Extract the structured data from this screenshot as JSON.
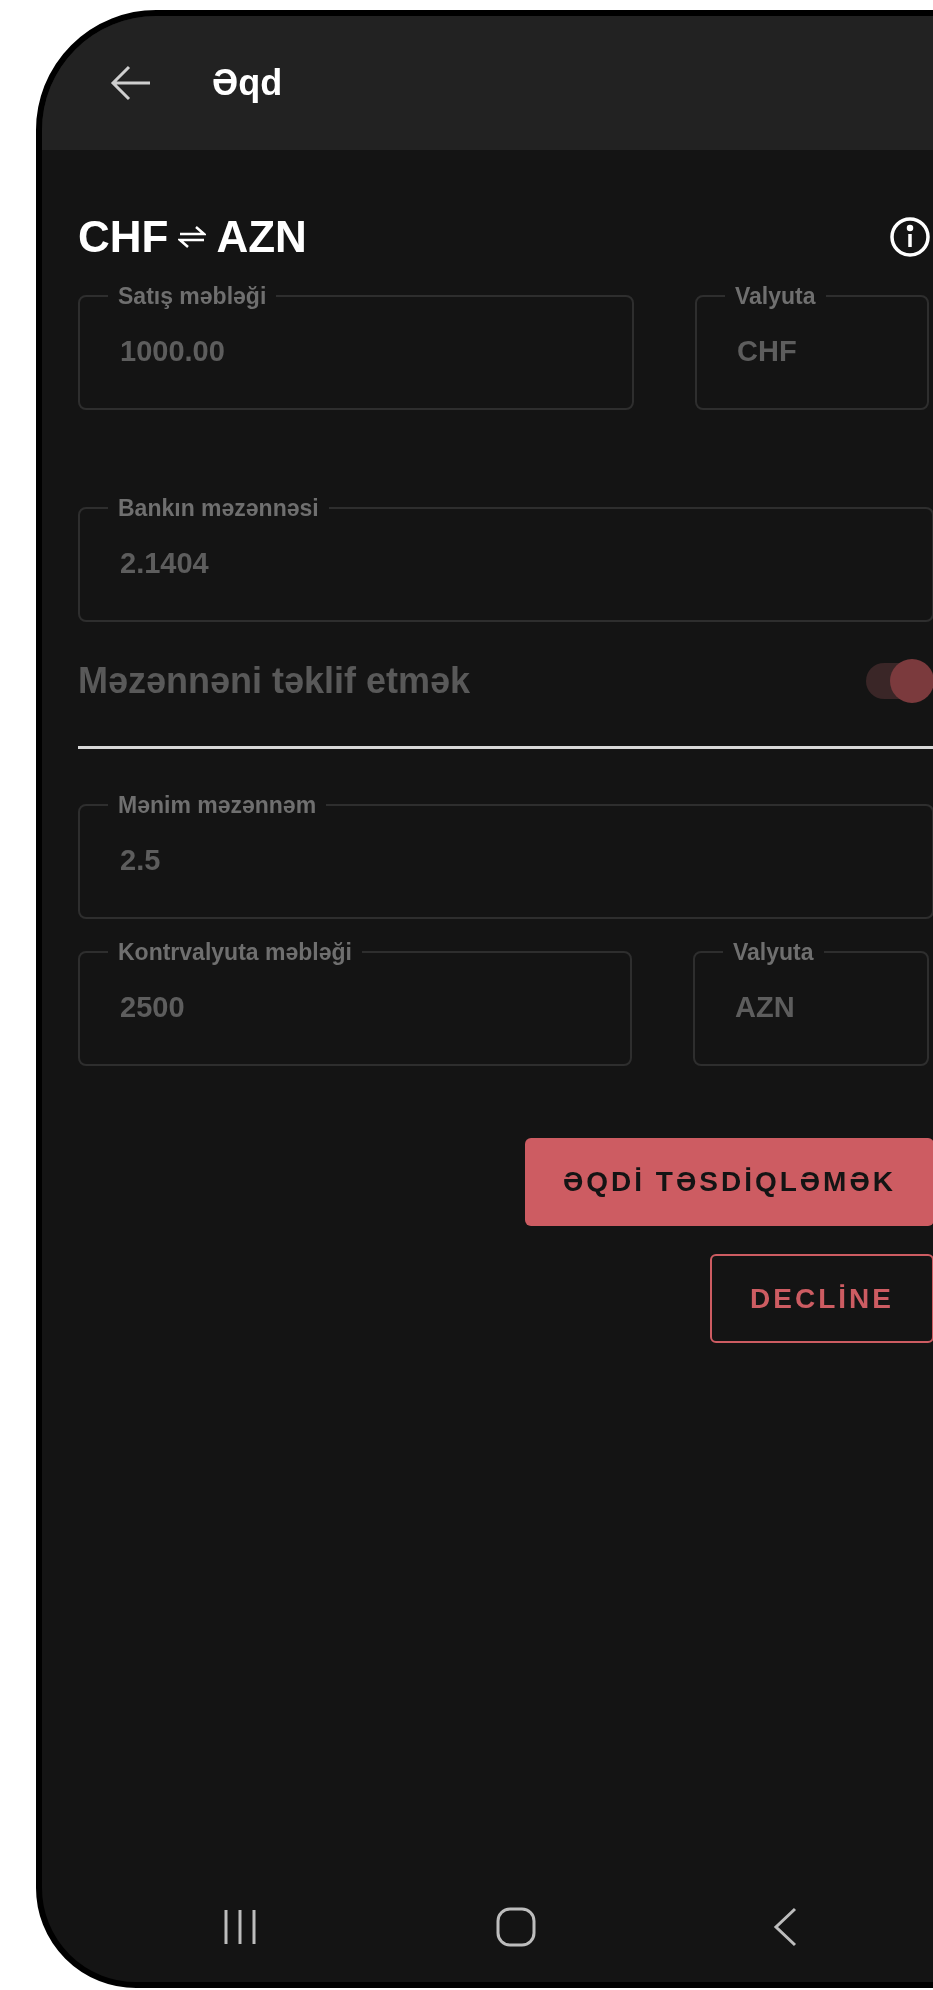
{
  "app_bar": {
    "title": "Əqd"
  },
  "pair": {
    "from": "CHF",
    "to": "AZN"
  },
  "fields_top": [
    {
      "label": "Satış məbləği",
      "value": "1000.00"
    },
    {
      "label": "Valyuta",
      "value": "CHF"
    }
  ],
  "bank_rate": {
    "label": "Bankın məzənnəsi",
    "value": "2.1404"
  },
  "offer_toggle": {
    "label": "Məzənnəni təklif etmək",
    "on": true
  },
  "my_rate": {
    "label": "Mənim məzənnəm",
    "value": "2.5"
  },
  "fields_bottom": [
    {
      "label": "Kontrvalyuta məbləği",
      "value": "2500"
    },
    {
      "label": "Valyuta",
      "value": "AZN"
    }
  ],
  "buttons": [
    {
      "kind": "filled",
      "label": "ƏQDİ TƏSDİQLƏMƏK"
    },
    {
      "kind": "outlined",
      "label": "DECLİNE"
    }
  ]
}
